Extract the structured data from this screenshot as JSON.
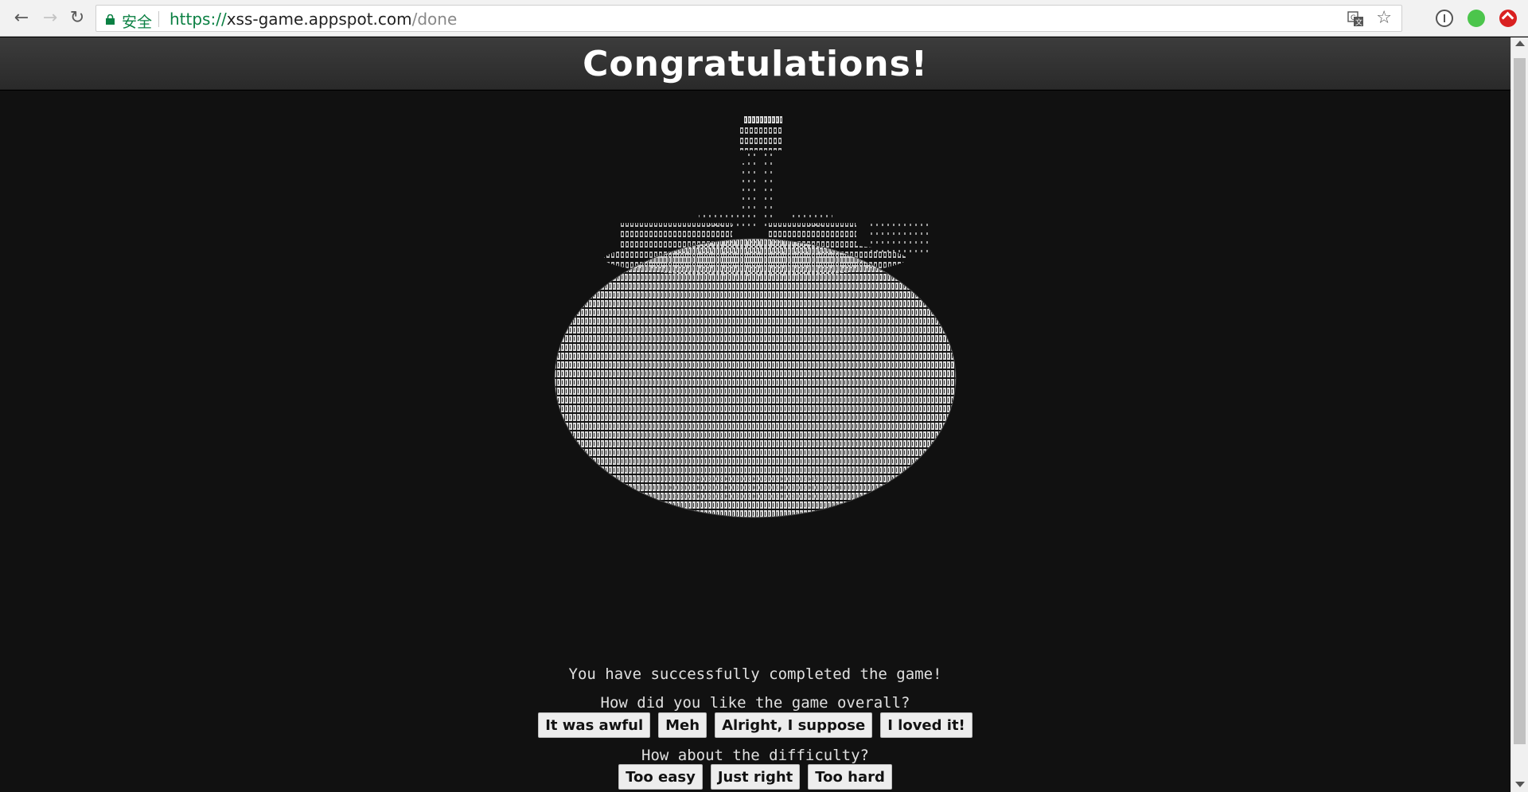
{
  "browser": {
    "secure_label": "安全",
    "url_scheme": "https://",
    "url_host": "xss-game.appspot.com",
    "url_path": "/done",
    "back_icon": "back-arrow-icon",
    "forward_icon": "forward-arrow-icon",
    "reload_icon": "reload-icon",
    "star_icon": "bookmark-star-icon"
  },
  "page": {
    "title": "Congratulations!",
    "completed_message": "You have successfully completed the game!",
    "overall_question": "How did you like the game overall?",
    "overall_options": [
      "It was awful",
      "Meh",
      "Alright, I suppose",
      "I loved it!"
    ],
    "difficulty_question": "How about the difficulty?",
    "difficulty_options": [
      "Too easy",
      "Just right",
      "Too hard"
    ]
  }
}
